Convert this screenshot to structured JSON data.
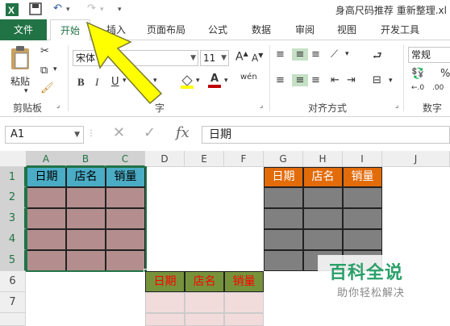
{
  "window": {
    "title": "身高尺码推荐   重新整理.xl"
  },
  "tabs": {
    "file": "文件",
    "home": "开始",
    "insert": "插入",
    "page_layout": "页面布局",
    "formulas": "公式",
    "data": "数据",
    "review": "审阅",
    "view": "视图",
    "developer": "开发工具"
  },
  "ribbon": {
    "paste_label": "粘贴",
    "clipboard_group": "剪贴板",
    "font_name": "宋体",
    "font_size": "11",
    "font_group": "字",
    "phonetic": "wén",
    "alignment_group": "对齐方式",
    "number_format": "常规",
    "number_group": "数字"
  },
  "formula_bar": {
    "name_box": "A1",
    "fx": "fx",
    "value": "日期"
  },
  "columns": [
    "A",
    "B",
    "C",
    "D",
    "E",
    "F",
    "G",
    "H",
    "I",
    "J"
  ],
  "rows": [
    "1",
    "2",
    "3",
    "4",
    "5",
    "6",
    "7"
  ],
  "tables": {
    "table1_headers": [
      "日期",
      "店名",
      "销量"
    ],
    "table2_headers": [
      "日期",
      "店名",
      "销量"
    ],
    "table3_headers": [
      "日期",
      "店名",
      "销量"
    ]
  },
  "watermark": {
    "main": "百科全说",
    "sub": "助你轻松解决"
  },
  "colors": {
    "excel_green": "#217346",
    "table1_header": "#4bacc6",
    "table1_body": "#b48e8e",
    "table2_header": "#e26b0a",
    "table2_body": "#808080",
    "table3_header": "#76933c",
    "table3_body": "#f2dcdb",
    "arrow": "#ffff00"
  }
}
